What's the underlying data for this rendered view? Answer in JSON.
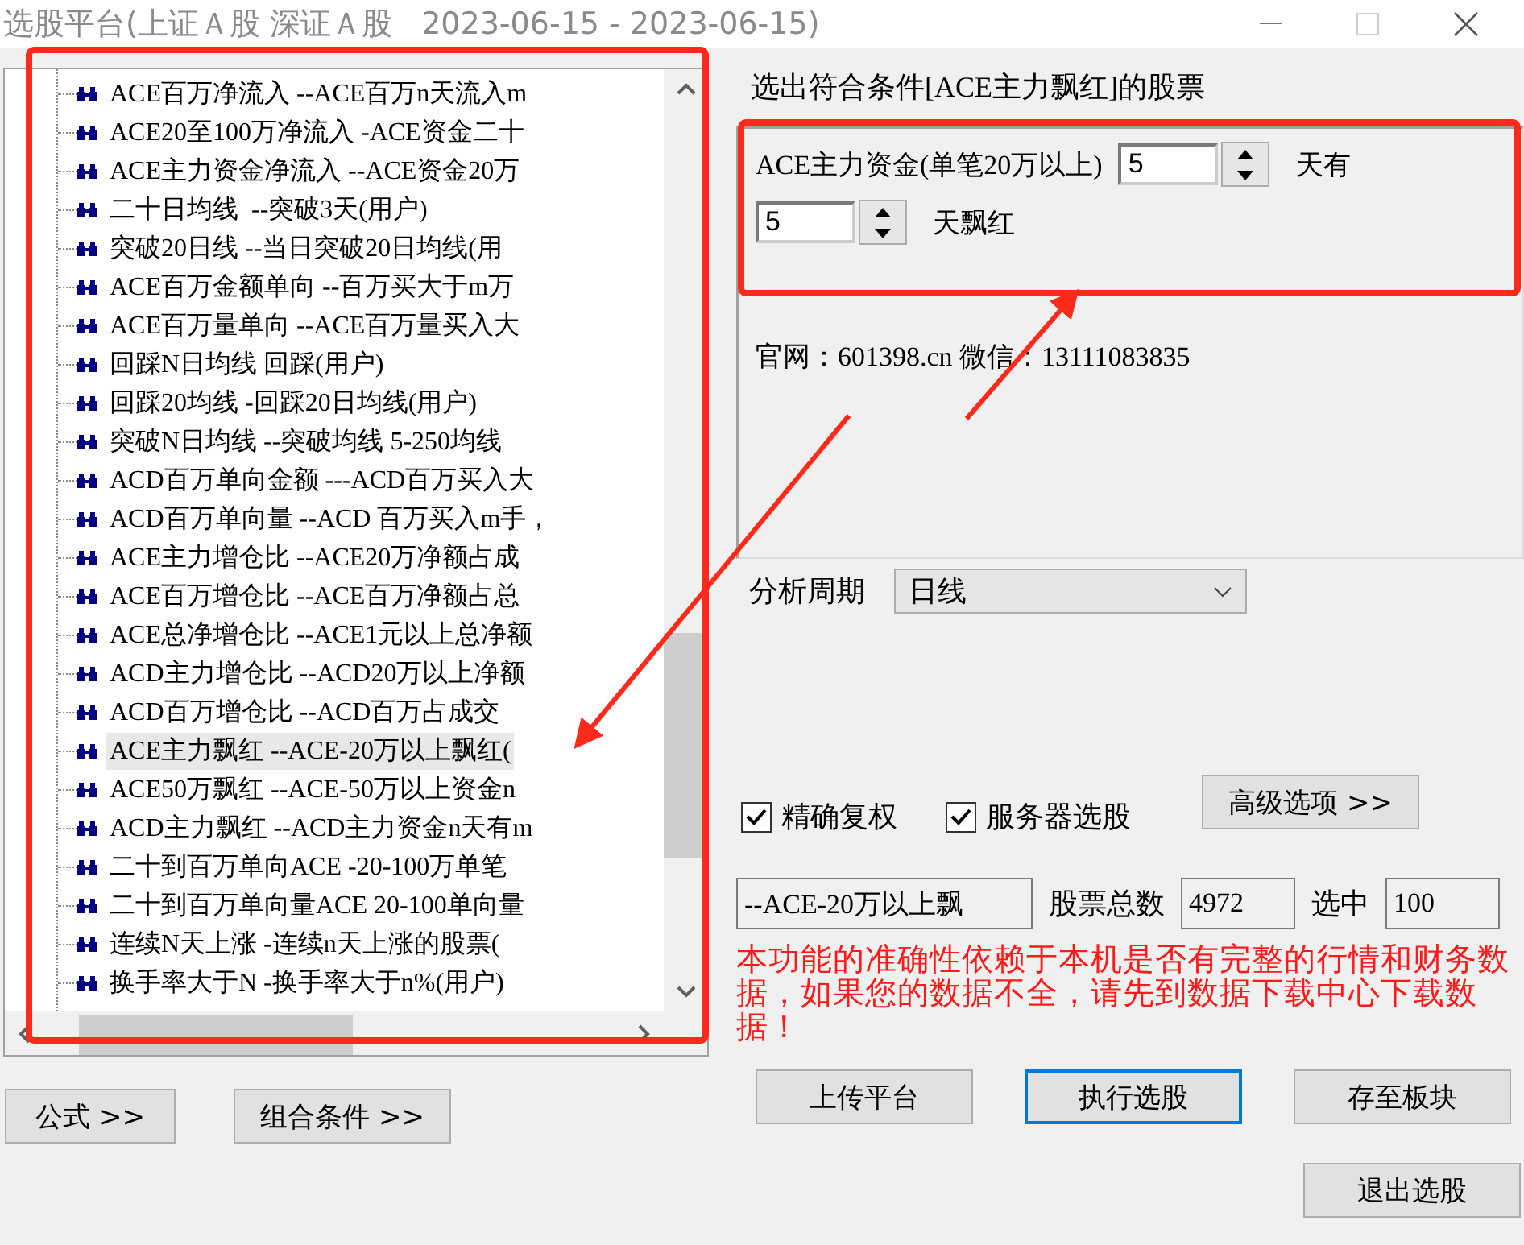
{
  "window": {
    "title": "选股平台(上证Ａ股 深证Ａ股   2023-06-15 - 2023-06-15)"
  },
  "tree": {
    "items": [
      {
        "label": "ACE百万净流入 --ACE百万n天流入m",
        "selected": false
      },
      {
        "label": "ACE20至100万净流入 -ACE资金二十",
        "selected": false
      },
      {
        "label": "ACE主力资金净流入 --ACE资金20万",
        "selected": false
      },
      {
        "label": "二十日均线  --突破3天(用户)",
        "selected": false
      },
      {
        "label": "突破20日线 --当日突破20日均线(用",
        "selected": false
      },
      {
        "label": "ACE百万金额单向 --百万买大于m万",
        "selected": false
      },
      {
        "label": "ACE百万量单向 --ACE百万量买入大",
        "selected": false
      },
      {
        "label": "回踩N日均线 回踩(用户)",
        "selected": false
      },
      {
        "label": "回踩20均线 -回踩20日均线(用户)",
        "selected": false
      },
      {
        "label": "突破N日均线 --突破均线 5-250均线",
        "selected": false
      },
      {
        "label": "ACD百万单向金额 ---ACD百万买入大",
        "selected": false
      },
      {
        "label": "ACD百万单向量 --ACD 百万买入m手，",
        "selected": false
      },
      {
        "label": "ACE主力增仓比 --ACE20万净额占成",
        "selected": false
      },
      {
        "label": "ACE百万增仓比 --ACE百万净额占总",
        "selected": false
      },
      {
        "label": "ACE总净增仓比 --ACE1元以上总净额",
        "selected": false
      },
      {
        "label": "ACD主力增仓比 --ACD20万以上净额",
        "selected": false
      },
      {
        "label": "ACD百万增仓比 --ACD百万占成交",
        "selected": false
      },
      {
        "label": "ACE主力飘红 --ACE-20万以上飘红(",
        "selected": true
      },
      {
        "label": "ACE50万飘红 --ACE-50万以上资金n",
        "selected": false
      },
      {
        "label": "ACD主力飘红 --ACD主力资金n天有m",
        "selected": false
      },
      {
        "label": "二十到百万单向ACE -20-100万单笔",
        "selected": false
      },
      {
        "label": "二十到百万单向量ACE 20-100单向量",
        "selected": false
      },
      {
        "label": "连续N天上涨 -连续n天上涨的股票(",
        "selected": false
      },
      {
        "label": "换手率大于N -换手率大于n%(用户)",
        "selected": false
      }
    ]
  },
  "left_buttons": [
    "公式 >>",
    "组合条件 >>"
  ],
  "heading": "选出符合条件[ACE主力飘红]的股票",
  "params": {
    "label_1": "ACE主力资金(单笔20万以上)",
    "value_1": "5",
    "label_2": "天有",
    "value_2": "5",
    "label_3": "天飘红"
  },
  "info": "官网：601398.cn 微信：13111083835",
  "period": {
    "label": "分析周期",
    "value": "日线"
  },
  "options": [
    {
      "label": "精确复权",
      "checked": true
    },
    {
      "label": "服务器选股",
      "checked": true
    }
  ],
  "advanced_button": "高级选项 >>",
  "summary": {
    "condition": "--ACE-20万以上飘",
    "total_label": "股票总数",
    "total": "4972",
    "selected_label": "选中",
    "selected": "100"
  },
  "warning": "本功能的准确性依赖于本机是否有完整的行情和财务数据，如果您的数据不全，请先到数据下载中心下载数据！",
  "action_buttons": [
    {
      "label": "上传平台",
      "default": false
    },
    {
      "label": "执行选股",
      "default": true
    },
    {
      "label": "存至板块",
      "default": false
    }
  ],
  "exit_button": "退出选股"
}
